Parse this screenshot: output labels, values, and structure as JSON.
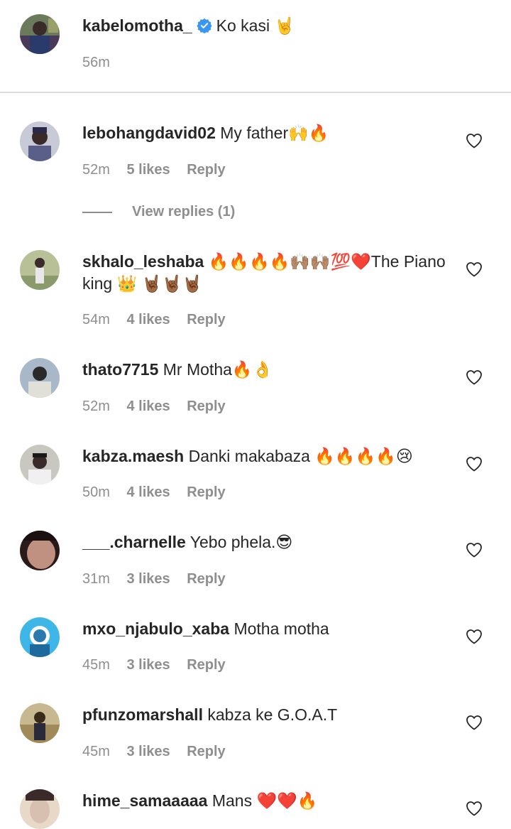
{
  "caption": {
    "username": "kabelomotha_",
    "text": "Ko kasi 🤘",
    "time": "56m",
    "verified": true
  },
  "comments": [
    {
      "username": "lebohangdavid02",
      "text": "My father🙌🔥",
      "time": "52m",
      "likes": "5 likes",
      "reply": "Reply",
      "view_replies": "View replies (1)",
      "avatar_color": "#5a5f8a"
    },
    {
      "username": "skhalo_leshaba",
      "text": "🔥🔥🔥🔥🙌🏽🙌🏽💯❤️The Piano king 👑 🤘🏾🤘🏾🤘🏾",
      "time": "54m",
      "likes": "4 likes",
      "reply": "Reply",
      "avatar_color": "#8a9a6a"
    },
    {
      "username": "thato7715",
      "text": "Mr Motha🔥👌",
      "time": "52m",
      "likes": "4 likes",
      "reply": "Reply",
      "avatar_color": "#4a5a7a"
    },
    {
      "username": "kabza.maesh",
      "text": "Danki makabaza 🔥🔥🔥🔥😢",
      "time": "50m",
      "likes": "4 likes",
      "reply": "Reply",
      "avatar_color": "#9a9a92"
    },
    {
      "username": "___.charnelle",
      "text": "Yebo phela.😎",
      "time": "31m",
      "likes": "3 likes",
      "reply": "Reply",
      "avatar_color": "#c09080"
    },
    {
      "username": "mxo_njabulo_xaba",
      "text": "Motha motha",
      "time": "45m",
      "likes": "3 likes",
      "reply": "Reply",
      "avatar_color": "#3fb6e8"
    },
    {
      "username": "pfunzomarshall",
      "text": "kabza ke G.O.A.T",
      "time": "45m",
      "likes": "3 likes",
      "reply": "Reply",
      "avatar_color": "#a08a5a"
    },
    {
      "username": "hime_samaaaaa",
      "text": "Mans ❤️❤️🔥",
      "avatar_color": "#d8c0b0"
    }
  ],
  "colors": {
    "text": "#262626",
    "meta": "#8e8e8e",
    "divider": "#dbdbdb",
    "verified": "#3897f0"
  },
  "icons": {
    "like": "heart-outline-icon",
    "verified": "verified-badge-icon"
  }
}
